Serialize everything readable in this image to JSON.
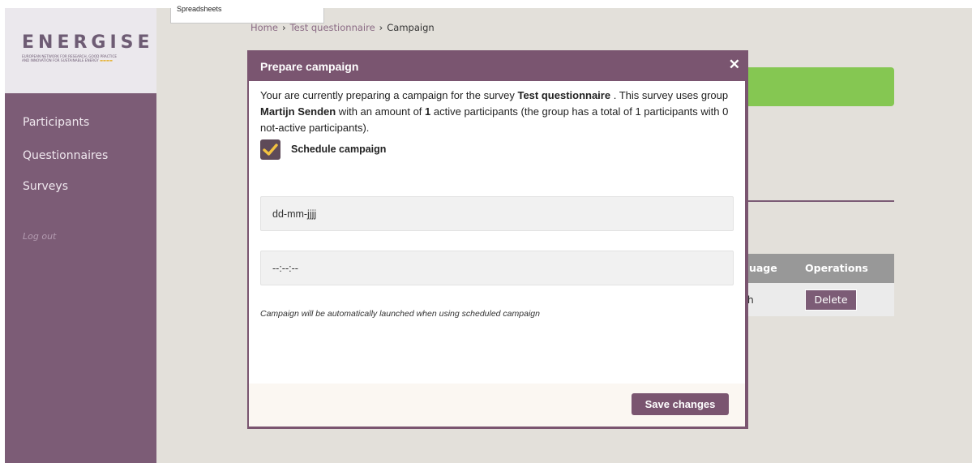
{
  "brand": {
    "name": "ENERGISE",
    "tagline_line1": "EUROPEAN NETWORK FOR RESEARCH, GOOD PRACTICE",
    "tagline_line2": "AND INNOVATION FOR SUSTAINABLE ENERGY"
  },
  "topbar": {
    "dropdown_item": "Spreadsheets"
  },
  "sidebar": {
    "items": [
      {
        "label": "Participants"
      },
      {
        "label": "Questionnaires"
      },
      {
        "label": "Surveys"
      }
    ],
    "logout_label": "Log out"
  },
  "breadcrumb": {
    "home": "Home",
    "separator": "›",
    "parent": "Test questionnaire",
    "current": "Campaign"
  },
  "background_table": {
    "headers": [
      "guage",
      "Operations"
    ],
    "rows": [
      {
        "language": "ch",
        "action": "Delete"
      }
    ]
  },
  "modal": {
    "title": "Prepare campaign",
    "close_glyph": "✕",
    "intro": {
      "t1": "Your are currently preparing a campaign for the survey ",
      "survey_name": "Test questionnaire",
      "t2": " . This survey uses group ",
      "group_name": "Martijn Senden",
      "t3": " with an amount of ",
      "active_count": "1",
      "t4": " active participants (the group has a total of 1 participants with 0 not-active participants)."
    },
    "schedule": {
      "label": "Schedule campaign",
      "checked": true
    },
    "date_field": {
      "value": "dd-mm-jjjj"
    },
    "time_field": {
      "value": "--:--:--"
    },
    "note": "Campaign will be automatically launched when using scheduled campaign",
    "save_label": "Save changes"
  },
  "colors": {
    "primary_purple": "#7a5570",
    "sidebar": "#7c5c76",
    "accent_green": "#85c752",
    "checkmark": "#f3c240"
  }
}
